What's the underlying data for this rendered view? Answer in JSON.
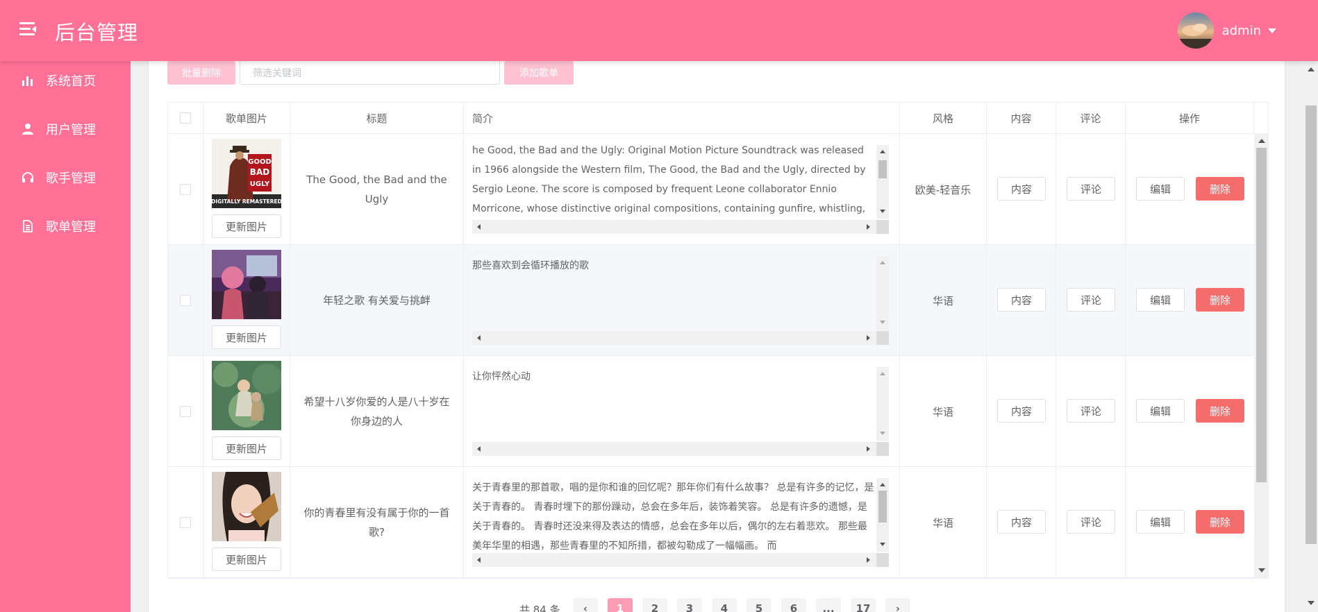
{
  "header": {
    "title": "后台管理",
    "username": "admin"
  },
  "sidebar": {
    "items": [
      {
        "label": "系统首页",
        "icon": "bar-chart-icon"
      },
      {
        "label": "用户管理",
        "icon": "user-icon"
      },
      {
        "label": "歌手管理",
        "icon": "headphones-icon"
      },
      {
        "label": "歌单管理",
        "icon": "document-icon"
      }
    ]
  },
  "toolbar": {
    "bulk_delete_label": "批量删除",
    "search_placeholder": "筛选关键词",
    "add_label": "添加歌单"
  },
  "table": {
    "headers": {
      "cover": "歌单图片",
      "title": "标题",
      "intro": "简介",
      "style": "风格",
      "content": "内容",
      "comment": "评论",
      "ops": "操作"
    },
    "update_label": "更新图片",
    "content_label": "内容",
    "comment_label": "评论",
    "edit_label": "编辑",
    "delete_label": "删除",
    "rows": [
      {
        "title": "The Good, the Bad and the Ugly",
        "intro": "he Good, the Bad and the Ugly: Original Motion Picture Soundtrack was released in 1966 alongside the Western film, The Good, the Bad and the Ugly, directed by Sergio Leone. The score is composed by frequent Leone collaborator Ennio Morricone, whose distinctive original compositions, containing gunfire, whistling, and yodeling permeate the film",
        "style": "欧美-轻音乐",
        "cover_text_main": "GOOD BAD UGLY",
        "cover_text_sub": "DIGITALLY REMASTERED"
      },
      {
        "title": "年轻之歌 有关爱与挑衅",
        "intro": "那些喜欢到会循环播放的歌",
        "style": "华语"
      },
      {
        "title": "希望十八岁你爱的人是八十岁在你身边的人",
        "intro": "让你怦然心动",
        "style": "华语"
      },
      {
        "title": "你的青春里有没有属于你的一首歌?",
        "intro": "关于青春里的那首歌，唱的是你和谁的回忆呢？那年你们有什么故事？ 总是有许多的记忆，是关于青春的。 青春时埋下的那份躁动，总会在多年后，装饰着笑容。 总是有许多的遗憾，是关于青春的。 青春时还没来得及表达的情感，总会在多年以后，偶尔的左右着悲欢。 那些最美年华里的相遇，那些青春里的不知所措，都被勾勒成了一幅幅画。 而",
        "style": "华语"
      }
    ]
  },
  "pagination": {
    "total": "共 84 条",
    "pages": [
      "1",
      "2",
      "3",
      "4",
      "5",
      "6",
      "...",
      "17"
    ],
    "active": "1",
    "prev": "‹",
    "next": "›"
  }
}
